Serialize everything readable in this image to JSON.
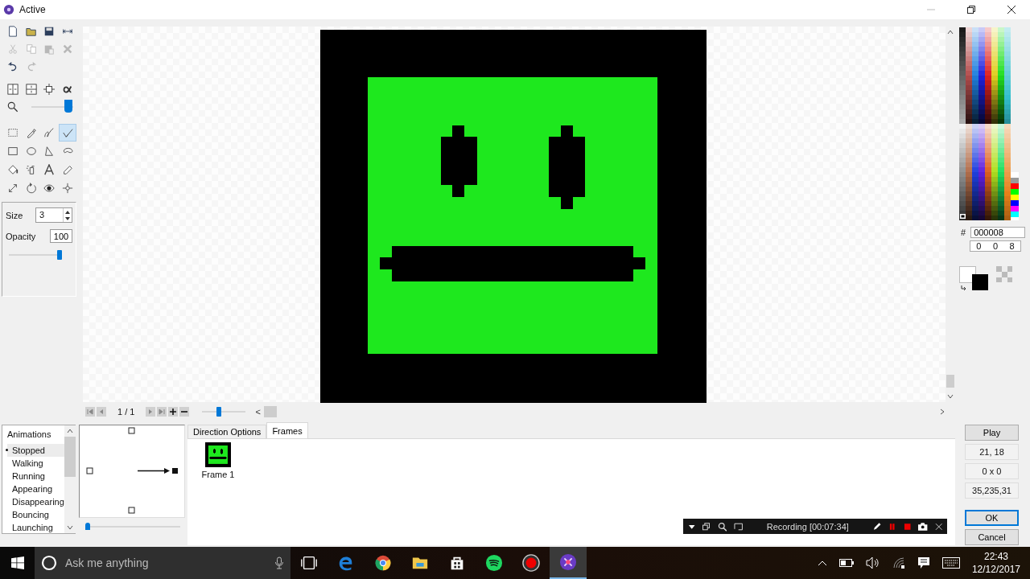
{
  "window": {
    "title": "Active"
  },
  "commands": [
    {
      "kind": "new",
      "disabled": false
    },
    {
      "kind": "open",
      "disabled": false
    },
    {
      "kind": "save",
      "disabled": false
    },
    {
      "kind": "import",
      "disabled": false
    },
    {
      "kind": "cut",
      "disabled": true
    },
    {
      "kind": "copy",
      "disabled": true
    },
    {
      "kind": "paste",
      "disabled": true
    },
    {
      "kind": "delete",
      "disabled": true
    },
    {
      "kind": "undo",
      "disabled": false
    },
    {
      "kind": "redo",
      "disabled": true
    }
  ],
  "zoom": {
    "level": 0.88
  },
  "tools": [
    {
      "kind": "select",
      "selected": false
    },
    {
      "kind": "dropper",
      "selected": false
    },
    {
      "kind": "freehand",
      "selected": false
    },
    {
      "kind": "line",
      "selected": true
    },
    {
      "kind": "rectangle",
      "selected": false
    },
    {
      "kind": "ellipse",
      "selected": false
    },
    {
      "kind": "polygon",
      "selected": false
    },
    {
      "kind": "shape",
      "selected": false
    },
    {
      "kind": "fill",
      "selected": false
    },
    {
      "kind": "spray",
      "selected": false
    },
    {
      "kind": "text",
      "selected": false
    },
    {
      "kind": "eraser",
      "selected": false
    },
    {
      "kind": "resize",
      "selected": false
    },
    {
      "kind": "rotate",
      "selected": false
    },
    {
      "kind": "view",
      "selected": false
    },
    {
      "kind": "hotspot",
      "selected": false
    }
  ],
  "size": {
    "label": "Size",
    "value": "3"
  },
  "opacity": {
    "label": "Opacity",
    "value": "100",
    "level": 1.0
  },
  "navigator": {
    "frame_counter": "1 / 1",
    "scroll_left": "<",
    "zoom_slider": {
      "level": 0.38
    }
  },
  "color": {
    "hash": "#",
    "hex": "000008",
    "rgb": [
      "0",
      "0",
      "8"
    ]
  },
  "animations": {
    "title": "Animations",
    "items": [
      {
        "label": "Stopped",
        "selected": true
      },
      {
        "label": "Walking",
        "selected": false
      },
      {
        "label": "Running",
        "selected": false
      },
      {
        "label": "Appearing",
        "selected": false
      },
      {
        "label": "Disappearing",
        "selected": false
      },
      {
        "label": "Bouncing",
        "selected": false
      },
      {
        "label": "Launching",
        "selected": false
      }
    ]
  },
  "speed_slider": {
    "level": 0.0
  },
  "tabs": [
    {
      "label": "Direction Options",
      "selected": false
    },
    {
      "label": "Frames",
      "selected": true
    }
  ],
  "frames": [
    {
      "label": "Frame 1"
    }
  ],
  "side_panel": {
    "play": "Play",
    "readouts": [
      "21, 18",
      "0 x 0",
      "35,235,31"
    ],
    "ok": "OK",
    "cancel": "Cancel"
  },
  "recording_bar": {
    "status": "Recording [00:07:34]"
  },
  "taskbar": {
    "search_placeholder": "Ask me anything",
    "apps": [
      {
        "kind": "task-view",
        "active": false
      },
      {
        "kind": "edge",
        "active": false
      },
      {
        "kind": "chrome",
        "active": false
      },
      {
        "kind": "explorer",
        "active": false
      },
      {
        "kind": "store",
        "active": false
      },
      {
        "kind": "spotify",
        "active": false
      },
      {
        "kind": "recorder",
        "active": false
      },
      {
        "kind": "fusion",
        "active": true
      }
    ],
    "time": "22:43",
    "date": "12/12/2017"
  }
}
